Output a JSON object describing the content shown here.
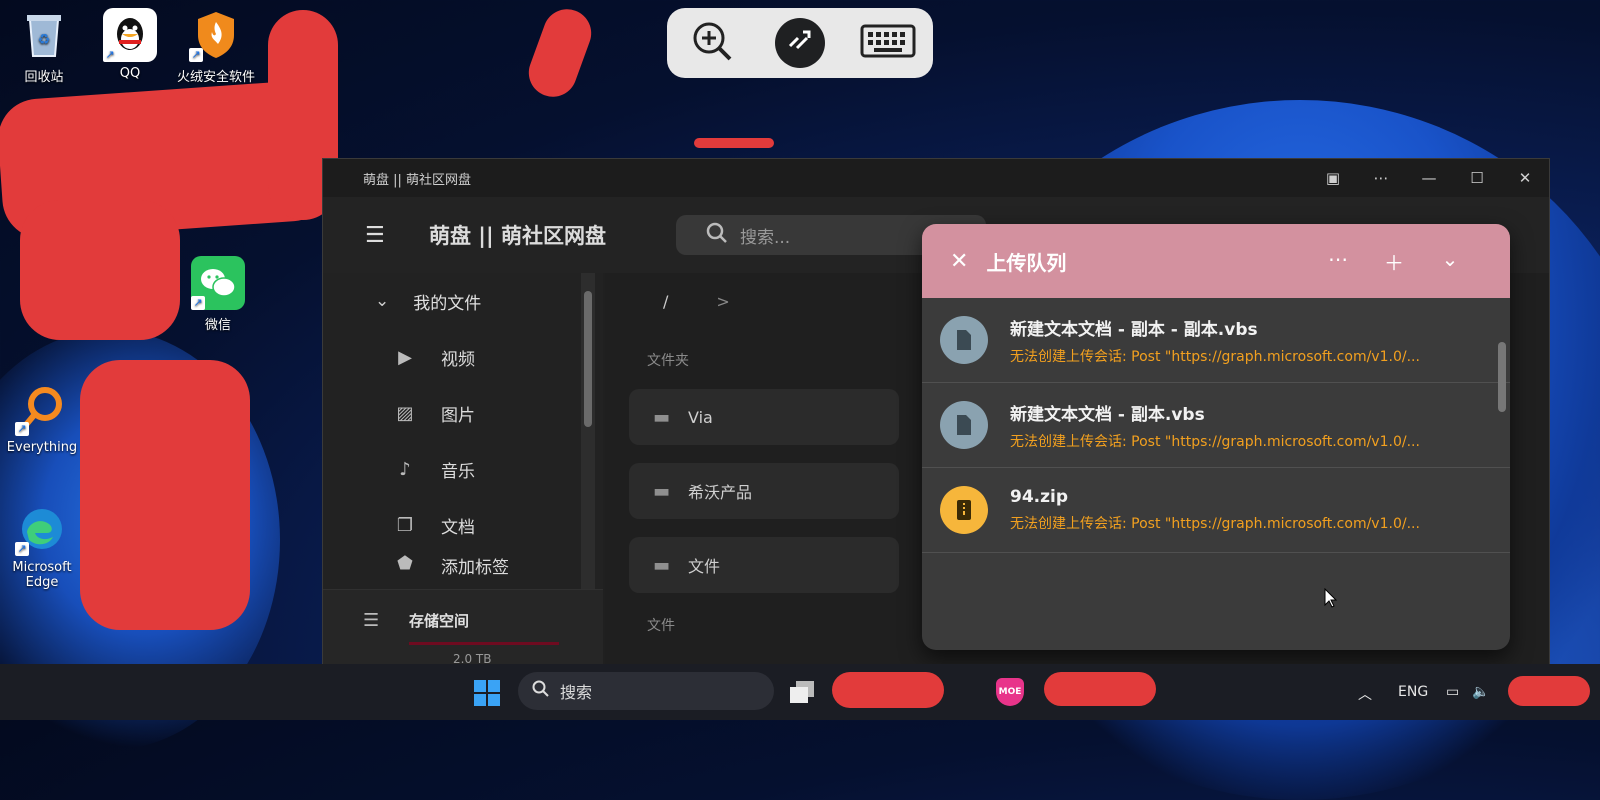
{
  "desktop": {
    "icons": [
      {
        "label": "回收站",
        "icon": "recycle-bin-icon"
      },
      {
        "label": "QQ",
        "icon": "qq-icon"
      },
      {
        "label": "火绒安全软件",
        "icon": "huorong-shield-icon"
      },
      {
        "label": "微信",
        "icon": "wechat-icon"
      },
      {
        "label": "Everything",
        "icon": "everything-search-icon"
      },
      {
        "label": "Microsoft Edge",
        "icon": "edge-icon"
      }
    ]
  },
  "remote_toolbar": {
    "buttons": [
      "zoom-in-icon",
      "remote-connect-icon",
      "keyboard-icon"
    ]
  },
  "window": {
    "title": "萌盘 || 萌社区网盘",
    "brand": "萌盘 || 萌社区网盘",
    "search_placeholder": "搜索...",
    "sidebar": {
      "section_label": "我的文件",
      "items": [
        {
          "label": "视频",
          "icon": "video-icon"
        },
        {
          "label": "图片",
          "icon": "image-icon"
        },
        {
          "label": "音乐",
          "icon": "music-icon"
        },
        {
          "label": "文档",
          "icon": "document-icon"
        },
        {
          "label": "添加标签",
          "icon": "tag-icon"
        }
      ],
      "storage_label": "存储空间",
      "storage_size": "2.0 TB"
    },
    "breadcrumb": {
      "root": "/",
      "separator": ">"
    },
    "sections": {
      "folders": "文件夹",
      "files": "文件"
    },
    "folders": [
      "Via",
      "希沃产品",
      "文件"
    ]
  },
  "upload_queue": {
    "title": "上传队列",
    "items": [
      {
        "name": "新建文本文档 - 副本 - 副本.vbs",
        "error": "无法创建上传会话: Post \"https://graph.microsoft.com/v1.0/...",
        "type": "file",
        "badge_color": "#8aa2b0"
      },
      {
        "name": "新建文本文档 - 副本.vbs",
        "error": "无法创建上传会话: Post \"https://graph.microsoft.com/v1.0/...",
        "type": "file",
        "badge_color": "#8aa2b0"
      },
      {
        "name": "94.zip",
        "error": "无法创建上传会话: Post \"https://graph.microsoft.com/v1.0/...",
        "type": "zip",
        "badge_color": "#f6b63b"
      }
    ]
  },
  "taskbar": {
    "search_label": "搜索",
    "language": "ENG"
  },
  "colors": {
    "queue_header": "#d3919f",
    "error_text": "#f2a01f",
    "storage_bar": "#6e0b20"
  }
}
